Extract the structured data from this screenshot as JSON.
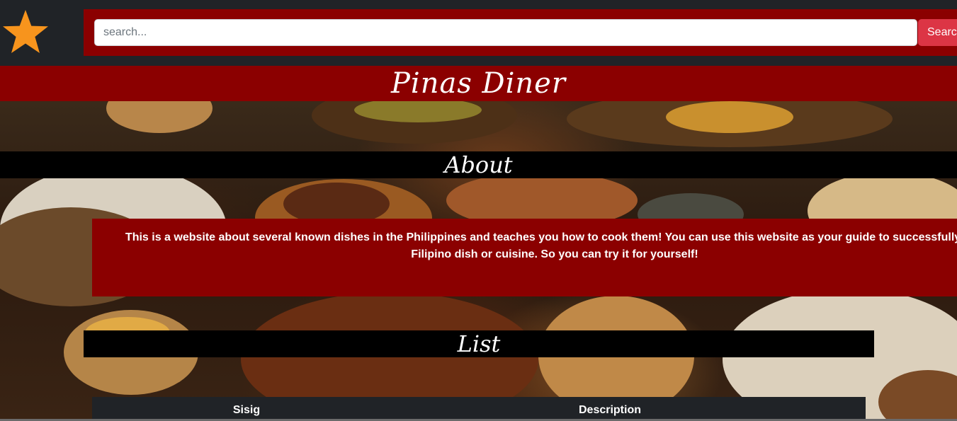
{
  "header": {
    "logo_icon": "star-icon",
    "logo_color": "#f7941d",
    "search": {
      "placeholder": "search...",
      "value": "",
      "button_label": "Searc"
    }
  },
  "site": {
    "title": "Pinas Diner",
    "brand_color": "#8b0000"
  },
  "about": {
    "heading": "About",
    "text": "This is a website about several known dishes in the Philippines and teaches you how to cook them! You can use this website as your guide to successfully coo Filipino dish or cuisine. So you can try it for yourself!"
  },
  "list": {
    "heading": "List",
    "columns": [
      "Sisig",
      "Description"
    ]
  }
}
